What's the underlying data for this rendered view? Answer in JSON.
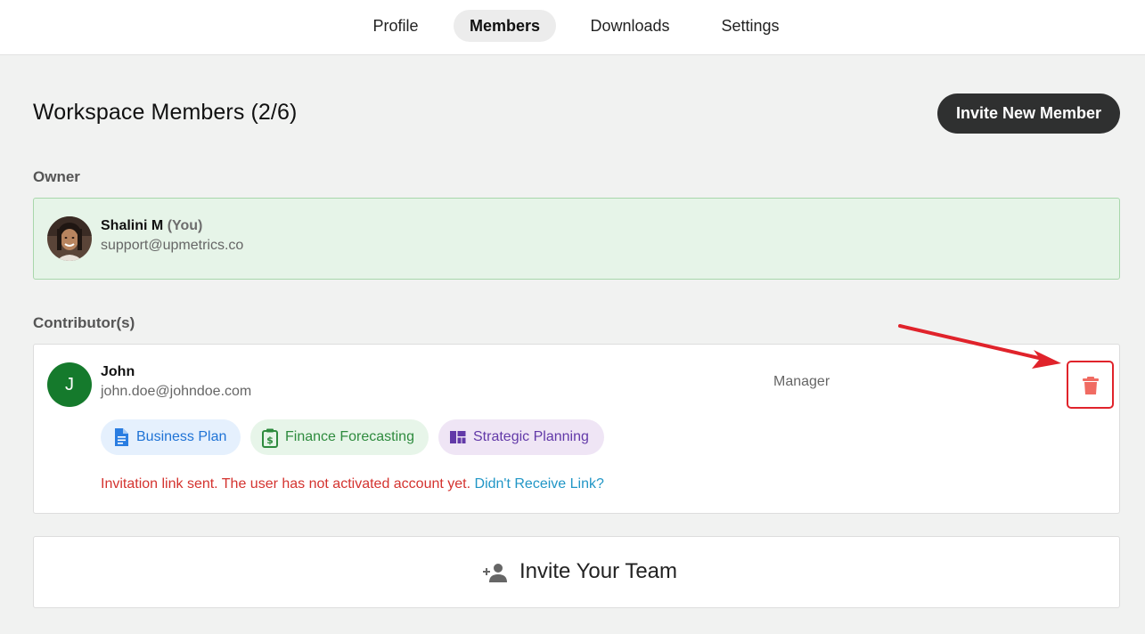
{
  "nav": {
    "tabs": [
      {
        "label": "Profile",
        "active": false
      },
      {
        "label": "Members",
        "active": true
      },
      {
        "label": "Downloads",
        "active": false
      },
      {
        "label": "Settings",
        "active": false
      }
    ]
  },
  "header": {
    "title": "Workspace Members (2/6)",
    "invite_button": "Invite New Member"
  },
  "owner": {
    "section_label": "Owner",
    "name": "Shalini M",
    "you_tag": "(You)",
    "email": "support@upmetrics.co"
  },
  "contributors": {
    "section_label": "Contributor(s)",
    "items": [
      {
        "initial": "J",
        "name": "John",
        "email": "john.doe@johndoe.com",
        "role": "Manager",
        "modules": [
          {
            "label": "Business Plan",
            "icon": "document-icon",
            "color": "#1f73d6"
          },
          {
            "label": "Finance Forecasting",
            "icon": "finance-clipboard-icon",
            "color": "#2e8b3e"
          },
          {
            "label": "Strategic Planning",
            "icon": "dashboard-icon",
            "color": "#6239a8"
          }
        ],
        "status_text": "Invitation link sent. The user has not activated account yet.",
        "resend_link": "Didn't Receive Link?",
        "delete_icon": "trash-icon"
      }
    ]
  },
  "invite_team": {
    "label": "Invite Your Team",
    "icon": "add-person-icon"
  },
  "colors": {
    "owner_card_bg": "#e6f4e8",
    "avatar_bg": "#157a2c",
    "delete": "#f06b62",
    "annotation": "#e0232b",
    "status_error": "#d4332f",
    "link": "#2196c6"
  }
}
